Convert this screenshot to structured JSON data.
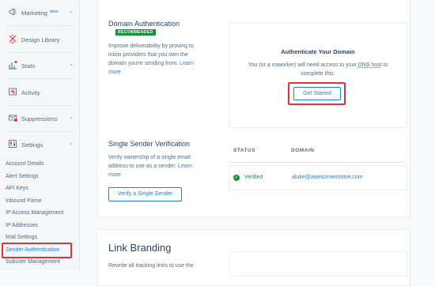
{
  "sidebar": {
    "items": [
      {
        "label": "Marketing",
        "badge": "NEW",
        "icon": "megaphone-icon"
      },
      {
        "label": "Design Library",
        "icon": "palette-icon"
      },
      {
        "label": "Stats",
        "icon": "stats-icon"
      },
      {
        "label": "Activity",
        "icon": "activity-icon"
      },
      {
        "label": "Suppressions",
        "icon": "suppressions-icon"
      },
      {
        "label": "Settings",
        "icon": "settings-icon"
      }
    ],
    "settings_subitems": [
      "Account Details",
      "Alert Settings",
      "API Keys",
      "Inbound Parse",
      "IP Access Management",
      "IP Addresses",
      "Mail Settings",
      "Sender Authentication",
      "Subuser Management"
    ]
  },
  "domain_auth": {
    "title": "Domain Authentication",
    "badge": "RECOMMENDED",
    "description": "Improve deliverability by proving to inbox providers that you own the domain you're sending from.",
    "learn_more": "Learn more",
    "panel_title": "Authenticate Your Domain",
    "panel_text_1": "You (or a coworker) will need access to your",
    "panel_text_link": "DNS host",
    "panel_text_2": "to complete this.",
    "button": "Get Started"
  },
  "single_sender": {
    "title": "Single Sender Verification",
    "description": "Verify ownership of a single email address to use as a sender.",
    "learn_more": "Learn more",
    "button": "Verify a Single Sender",
    "table": {
      "headers": [
        "STATUS",
        "DOMAIN"
      ],
      "rows": [
        {
          "status": "Verified",
          "domain": "aluke@awesomemotive.com"
        }
      ]
    }
  },
  "link_branding": {
    "title": "Link Branding",
    "description": "Rewrite all tracking links to use the"
  },
  "colors": {
    "accent": "#1a82e2",
    "highlight": "#e0323a",
    "verified": "#1a8f3c"
  }
}
